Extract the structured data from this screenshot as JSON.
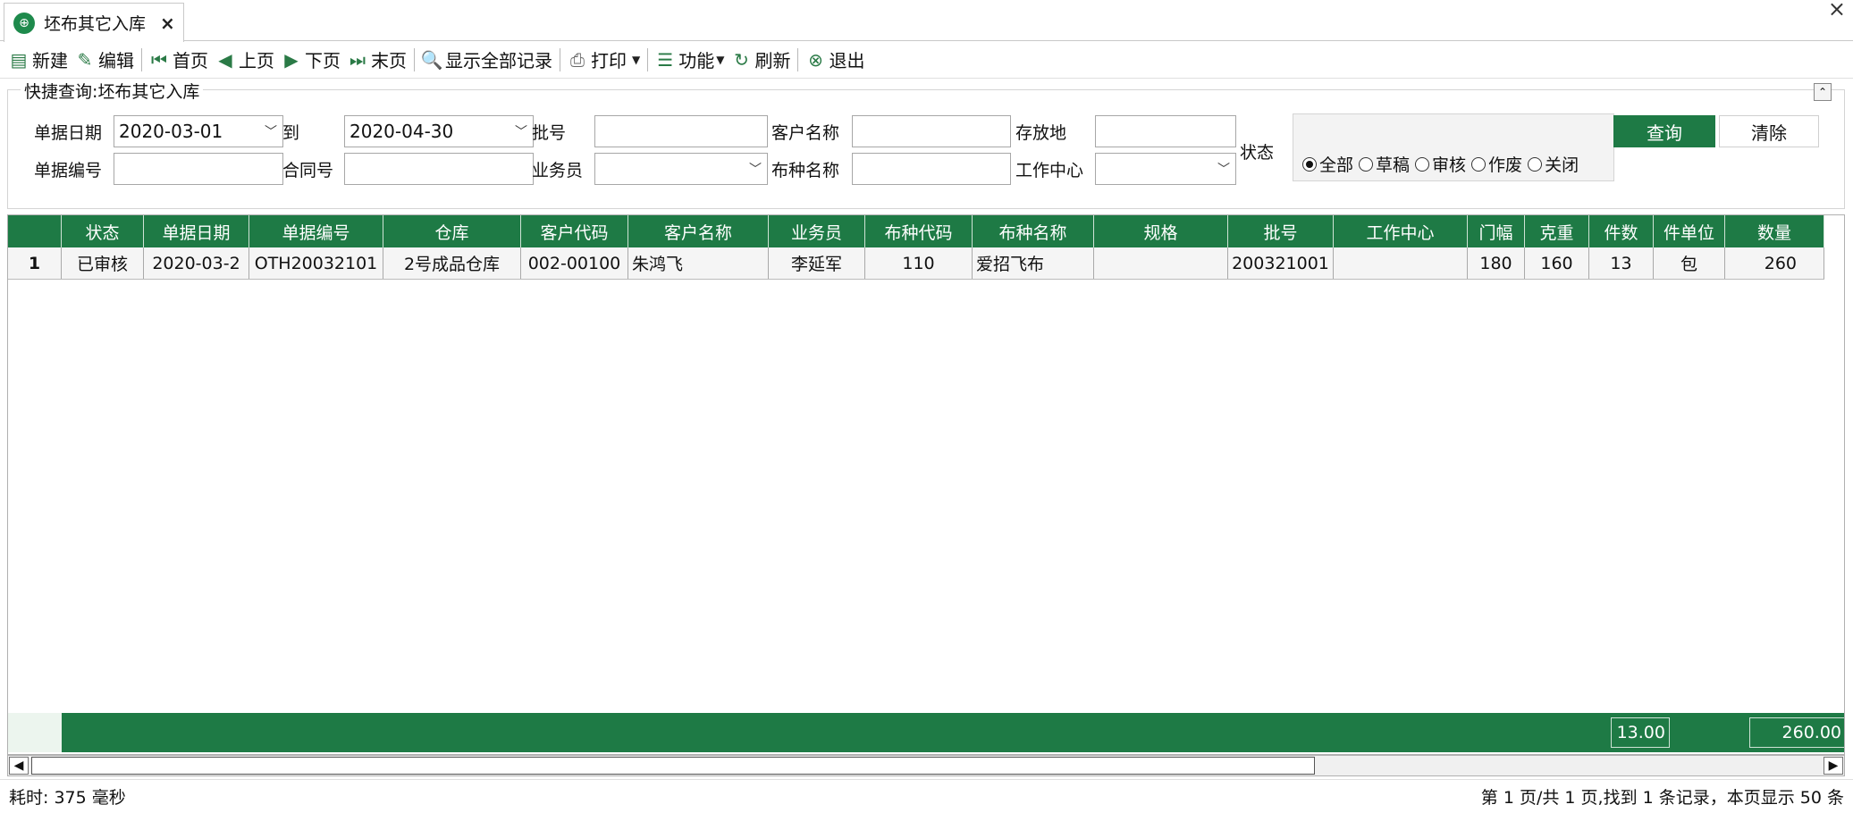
{
  "tab": {
    "title": "坯布其它入库",
    "close": "×"
  },
  "window": {
    "close": "×"
  },
  "toolbar": {
    "new": "新建",
    "edit": "编辑",
    "first": "首页",
    "prev": "上页",
    "next": "下页",
    "last": "末页",
    "show_all": "显示全部记录",
    "print": "打印",
    "functions": "功能",
    "refresh": "刷新",
    "exit": "退出"
  },
  "query": {
    "title": "快捷查询:坯布其它入库",
    "date_label": "单据日期",
    "date_from": "2020-03-01",
    "to_label": "到",
    "date_to": "2020-04-30",
    "batch_label": "批号",
    "customer_name_label": "客户名称",
    "storage_label": "存放地",
    "doc_no_label": "单据编号",
    "contract_label": "合同号",
    "salesman_label": "业务员",
    "fabric_name_label": "布种名称",
    "work_center_label": "工作中心",
    "status_label": "状态",
    "status_options": [
      "全部",
      "草稿",
      "审核",
      "作废",
      "关闭"
    ],
    "status_selected": "全部",
    "query_btn": "查询",
    "clear_btn": "清除"
  },
  "grid": {
    "columns": [
      "",
      "状态",
      "单据日期",
      "单据编号",
      "仓库",
      "客户代码",
      "客户名称",
      "业务员",
      "布种代码",
      "布种名称",
      "规格",
      "批号",
      "工作中心",
      "门幅",
      "克重",
      "件数",
      "件单位",
      "数量"
    ],
    "rows": [
      [
        "1",
        "已审核",
        "2020-03-2",
        "OTH20032101",
        "2号成品仓库",
        "002-00100",
        "朱鸿飞",
        "李延军",
        "110",
        "爱招飞布",
        "",
        "200321001",
        "",
        "180",
        "160",
        "13",
        "包",
        "260"
      ]
    ],
    "totals": {
      "pieces": "13.00",
      "quantity": "260.00"
    }
  },
  "statusbar": {
    "elapsed": "耗时: 375 毫秒",
    "paging": "第 1 页/共 1 页,找到 1 条记录，本页显示 50 条"
  },
  "colors": {
    "accent": "#1e7a45"
  }
}
